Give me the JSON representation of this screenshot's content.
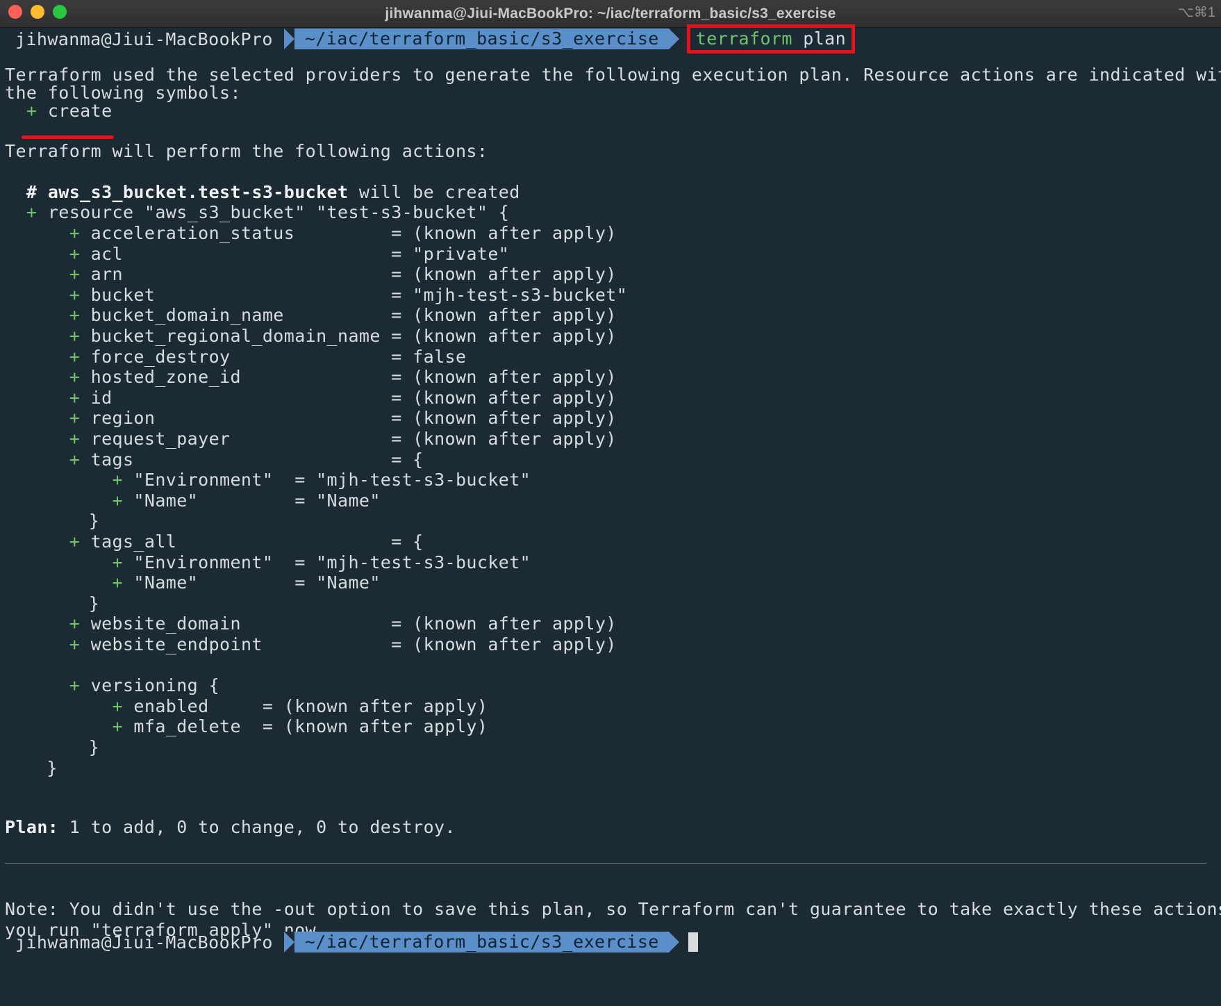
{
  "window": {
    "title": "jihwanma@Jiui-MacBookPro: ~/iac/terraform_basic/s3_exercise",
    "shortcut": "⌥⌘1"
  },
  "prompt": {
    "user": "jihwanma@Jiui-MacBookPro",
    "path": "~/iac/terraform_basic/s3_exercise",
    "command_keyword": "terraform",
    "command_arg": " plan"
  },
  "intro": {
    "line1": "Terraform used the selected providers to generate the following execution plan. Resource actions are indicated with",
    "line2": "the following symbols:",
    "symbol_plus": "  + ",
    "symbol_label": "create",
    "perform": "Terraform will perform the following actions:"
  },
  "resource": {
    "comment_hash": "  # ",
    "comment_name": "aws_s3_bucket.test-s3-bucket",
    "comment_rest": " will be created",
    "decl_plus": "  + ",
    "decl": "resource \"aws_s3_bucket\" \"test-s3-bucket\" {",
    "attributes": [
      {
        "name": "acceleration_status        ",
        "value": "= (known after apply)"
      },
      {
        "name": "acl                        ",
        "value": "= \"private\""
      },
      {
        "name": "arn                        ",
        "value": "= (known after apply)"
      },
      {
        "name": "bucket                     ",
        "value": "= \"mjh-test-s3-bucket\""
      },
      {
        "name": "bucket_domain_name         ",
        "value": "= (known after apply)"
      },
      {
        "name": "bucket_regional_domain_name",
        "value": "= (known after apply)"
      },
      {
        "name": "force_destroy              ",
        "value": "= false"
      },
      {
        "name": "hosted_zone_id             ",
        "value": "= (known after apply)"
      },
      {
        "name": "id                         ",
        "value": "= (known after apply)"
      },
      {
        "name": "region                     ",
        "value": "= (known after apply)"
      },
      {
        "name": "request_payer              ",
        "value": "= (known after apply)"
      },
      {
        "name": "tags                       ",
        "value": "= {"
      }
    ],
    "tags": [
      {
        "name": "\"Environment\"",
        "value": " = \"mjh-test-s3-bucket\""
      },
      {
        "name": "\"Name\"       ",
        "value": " = \"Name\""
      }
    ],
    "tags_all_name": "tags_all                   ",
    "tags_all_value": "= {",
    "tags_all": [
      {
        "name": "\"Environment\"",
        "value": " = \"mjh-test-s3-bucket\""
      },
      {
        "name": "\"Name\"       ",
        "value": " = \"Name\""
      }
    ],
    "close_brace": "}",
    "website": [
      {
        "name": "website_domain             ",
        "value": "= (known after apply)"
      },
      {
        "name": "website_endpoint           ",
        "value": "= (known after apply)"
      }
    ],
    "versioning_open": "versioning {",
    "versioning": [
      {
        "name": "enabled   ",
        "value": " = (known after apply)"
      },
      {
        "name": "mfa_delete",
        "value": " = (known after apply)"
      }
    ]
  },
  "plan": {
    "label": "Plan:",
    "summary": " 1 to add, 0 to change, 0 to destroy."
  },
  "note": {
    "line1": "Note: You didn't use the -out option to save this plan, so Terraform can't guarantee to take exactly these actions if",
    "line2": "you run \"terraform apply\" now."
  },
  "colors": {
    "background": "#1b2a33",
    "plus": "#6fc36a",
    "path_segment": "#5b8fc9",
    "highlight": "#e3121b"
  }
}
